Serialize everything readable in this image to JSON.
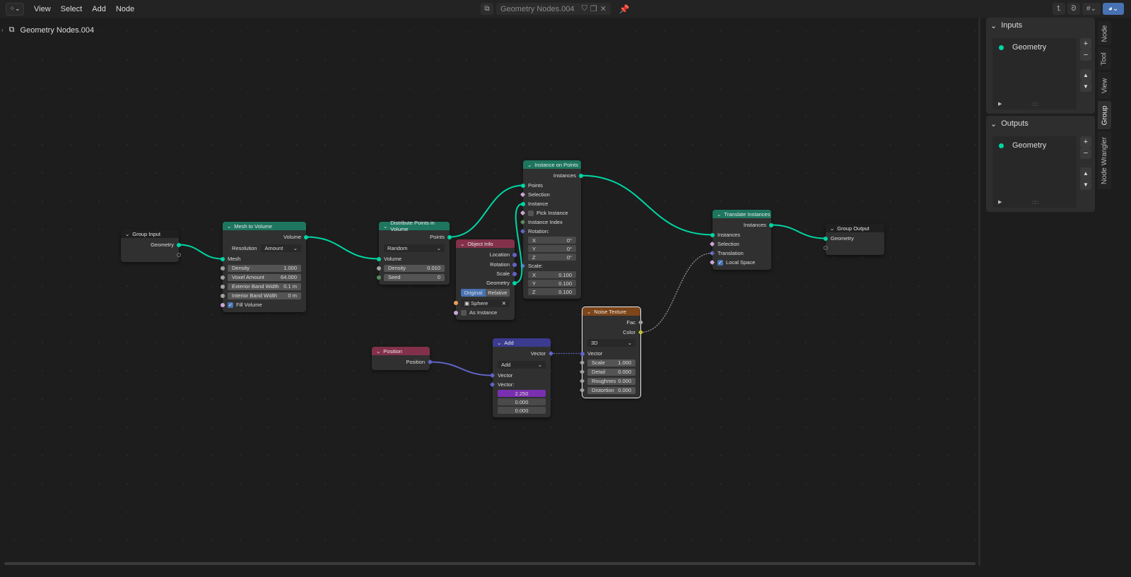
{
  "header": {
    "editor_type_icon": "node-editor-icon",
    "menus": [
      "View",
      "Select",
      "Add",
      "Node"
    ],
    "node_tree_name": "Geometry Nodes.004",
    "breadcrumb": "Geometry Nodes.004"
  },
  "colors": {
    "geometry_socket": "#00d6a3",
    "vector_socket": "#6363c7",
    "float_socket": "#a1a1a1",
    "integer_socket": "#598c5c",
    "boolean_socket": "#cca6d6",
    "object_socket": "#ed9e5c",
    "color_socket": "#c7c729",
    "geometry_header": "#1e765f",
    "input_header": "#83314a",
    "vector_header": "#3b3b8f",
    "texture_header": "#7d4519",
    "group_header": "#1f1f1f",
    "accent": "#4772b3"
  },
  "nodes": [
    {
      "id": "group_input",
      "title": "Group Input",
      "header": "group_header",
      "rows": [
        {
          "kind": "out",
          "label": "Geometry",
          "socket": "geometry_socket"
        },
        {
          "kind": "emptyout"
        }
      ]
    },
    {
      "id": "mesh_to_volume",
      "title": "Mesh to Volume",
      "header": "geometry_header",
      "rows": [
        {
          "kind": "out",
          "label": "Volume",
          "socket": "geometry_socket"
        },
        {
          "kind": "dropdown",
          "label": "Resolution",
          "value": "Amount"
        },
        {
          "kind": "in",
          "label": "Mesh",
          "socket": "geometry_socket"
        },
        {
          "kind": "field",
          "label": "Density",
          "value": "1.000",
          "socket": "float_socket"
        },
        {
          "kind": "field",
          "label": "Voxel Amount",
          "value": "64.000",
          "socket": "float_socket"
        },
        {
          "kind": "field",
          "label": "Exterior Band Width",
          "value": "0.1 m",
          "socket": "float_socket"
        },
        {
          "kind": "field",
          "label": "Interior Band Width",
          "value": "0 m",
          "socket": "float_socket"
        },
        {
          "kind": "check",
          "label": "Fill Volume",
          "checked": true,
          "socket": "boolean_socket"
        }
      ]
    },
    {
      "id": "distribute",
      "title": "Distribute Points in Volume",
      "header": "geometry_header",
      "rows": [
        {
          "kind": "out",
          "label": "Points",
          "socket": "geometry_socket"
        },
        {
          "kind": "dropdown",
          "value": "Random"
        },
        {
          "kind": "in",
          "label": "Volume",
          "socket": "geometry_socket"
        },
        {
          "kind": "field",
          "label": "Density",
          "value": "0.010",
          "socket": "float_socket"
        },
        {
          "kind": "field",
          "label": "Seed",
          "value": "0",
          "socket": "integer_socket"
        }
      ]
    },
    {
      "id": "object_info",
      "title": "Object Info",
      "header": "input_header",
      "rows": [
        {
          "kind": "out",
          "label": "Location",
          "socket": "vector_socket"
        },
        {
          "kind": "out",
          "label": "Rotation",
          "socket": "vector_socket"
        },
        {
          "kind": "out",
          "label": "Scale",
          "socket": "vector_socket"
        },
        {
          "kind": "out",
          "label": "Geometry",
          "socket": "geometry_socket"
        },
        {
          "kind": "toggle",
          "options": [
            "Original",
            "Relative"
          ],
          "selected": 0
        },
        {
          "kind": "object",
          "value": "Sphere",
          "socket": "object_socket"
        },
        {
          "kind": "check",
          "label": "As Instance",
          "checked": false,
          "socket": "boolean_socket"
        }
      ]
    },
    {
      "id": "instance_on_points",
      "title": "Instance on Points",
      "header": "geometry_header",
      "rows": [
        {
          "kind": "out",
          "label": "Instances",
          "socket": "geometry_socket"
        },
        {
          "kind": "in",
          "label": "Points",
          "socket": "geometry_socket"
        },
        {
          "kind": "in",
          "label": "Selection",
          "socket": "boolean_socket",
          "field": true
        },
        {
          "kind": "in",
          "label": "Instance",
          "socket": "geometry_socket"
        },
        {
          "kind": "check",
          "label": "Pick Instance",
          "checked": false,
          "socket": "boolean_socket",
          "field": true
        },
        {
          "kind": "in",
          "label": "Instance Index",
          "socket": "integer_socket",
          "field": true
        },
        {
          "kind": "in",
          "label": "Rotation:",
          "socket": "vector_socket",
          "field": true
        },
        {
          "kind": "sub",
          "label": "X",
          "value": "0°"
        },
        {
          "kind": "sub",
          "label": "Y",
          "value": "0°"
        },
        {
          "kind": "sub",
          "label": "Z",
          "value": "0°"
        },
        {
          "kind": "in",
          "label": "Scale:",
          "socket": "vector_socket",
          "field": true
        },
        {
          "kind": "sub",
          "label": "X",
          "value": "0.100"
        },
        {
          "kind": "sub",
          "label": "Y",
          "value": "0.100"
        },
        {
          "kind": "sub",
          "label": "Z",
          "value": "0.100"
        }
      ]
    },
    {
      "id": "translate",
      "title": "Translate Instances",
      "header": "geometry_header",
      "rows": [
        {
          "kind": "out",
          "label": "Instances",
          "socket": "geometry_socket"
        },
        {
          "kind": "in",
          "label": "Instances",
          "socket": "geometry_socket"
        },
        {
          "kind": "in",
          "label": "Selection",
          "socket": "boolean_socket",
          "field": true
        },
        {
          "kind": "in",
          "label": "Translation",
          "socket": "vector_socket",
          "field": true
        },
        {
          "kind": "check",
          "label": "Local Space",
          "checked": true,
          "socket": "boolean_socket",
          "field": true
        }
      ]
    },
    {
      "id": "group_output",
      "title": "Group Output",
      "header": "group_header",
      "rows": [
        {
          "kind": "in",
          "label": "Geometry",
          "socket": "geometry_socket"
        },
        {
          "kind": "emptyin"
        }
      ]
    },
    {
      "id": "noise",
      "title": "Noise Texture",
      "header": "texture_header",
      "selected": true,
      "rows": [
        {
          "kind": "out",
          "label": "Fac",
          "socket": "float_socket",
          "field": true
        },
        {
          "kind": "out",
          "label": "Color",
          "socket": "color_socket",
          "field": true
        },
        {
          "kind": "dropdown",
          "value": "3D"
        },
        {
          "kind": "in",
          "label": "Vector",
          "socket": "vector_socket"
        },
        {
          "kind": "field",
          "label": "Scale",
          "value": "1.000",
          "socket": "float_socket",
          "field": true
        },
        {
          "kind": "field",
          "label": "Detail",
          "value": "0.000",
          "socket": "float_socket",
          "field": true
        },
        {
          "kind": "field",
          "label": "Roughnes",
          "value": "0.000",
          "socket": "float_socket",
          "field": true
        },
        {
          "kind": "field",
          "label": "Distortion",
          "value": "0.000",
          "socket": "float_socket",
          "field": true
        }
      ]
    },
    {
      "id": "position",
      "title": "Position",
      "header": "input_header",
      "rows": [
        {
          "kind": "out",
          "label": "Position",
          "socket": "vector_socket",
          "field": true
        }
      ]
    },
    {
      "id": "add",
      "title": "Add",
      "header": "vector_header",
      "rows": [
        {
          "kind": "out",
          "label": "Vector",
          "socket": "vector_socket",
          "field": true
        },
        {
          "kind": "dropdown",
          "value": "Add"
        },
        {
          "kind": "in",
          "label": "Vector",
          "socket": "vector_socket",
          "field": true
        },
        {
          "kind": "in",
          "label": "Vector:",
          "socket": "vector_socket",
          "field": true
        },
        {
          "kind": "sub",
          "value": "2.250",
          "highlight": true
        },
        {
          "kind": "sub",
          "value": "0.000"
        },
        {
          "kind": "sub",
          "value": "0.000"
        }
      ]
    }
  ],
  "links": [
    {
      "from": [
        "group_input",
        0
      ],
      "to": [
        "mesh_to_volume",
        2
      ],
      "color": "geometry_socket"
    },
    {
      "from": [
        "mesh_to_volume",
        0
      ],
      "to": [
        "distribute",
        2
      ],
      "color": "geometry_socket"
    },
    {
      "from": [
        "distribute",
        0
      ],
      "to": [
        "instance_on_points",
        1
      ],
      "color": "geometry_socket"
    },
    {
      "from": [
        "object_info",
        3
      ],
      "to": [
        "instance_on_points",
        3
      ],
      "color": "geometry_socket"
    },
    {
      "from": [
        "instance_on_points",
        0
      ],
      "to": [
        "translate",
        1
      ],
      "color": "geometry_socket"
    },
    {
      "from": [
        "translate",
        0
      ],
      "to": [
        "group_output",
        0
      ],
      "color": "geometry_socket"
    },
    {
      "from": [
        "position",
        0
      ],
      "to": [
        "add",
        2
      ],
      "color": "vector_socket"
    },
    {
      "from": [
        "add",
        0
      ],
      "to": [
        "noise",
        3
      ],
      "color": "vector_socket",
      "dashed": true
    },
    {
      "from": [
        "noise",
        1
      ],
      "to": [
        "translate",
        3
      ],
      "color": "float_socket",
      "dashed": true
    }
  ],
  "sidebar": {
    "tabs": [
      "Node",
      "Tool",
      "View",
      "Group",
      "Node Wrangler"
    ],
    "active_tab": "Group",
    "inputs": {
      "title": "Inputs",
      "items": [
        "Geometry"
      ]
    },
    "outputs": {
      "title": "Outputs",
      "items": [
        "Geometry"
      ]
    }
  }
}
